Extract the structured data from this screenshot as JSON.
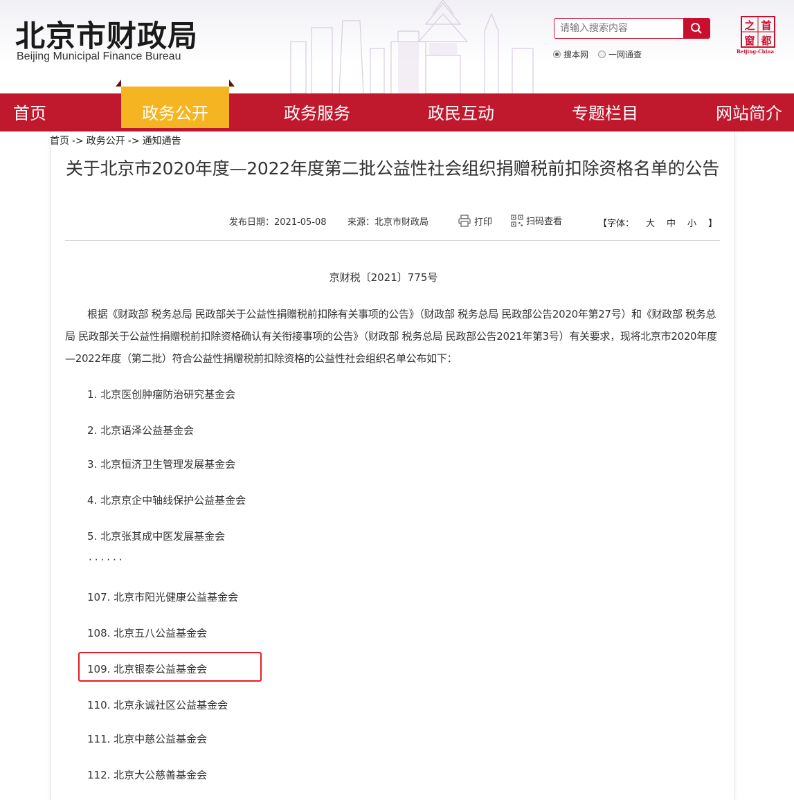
{
  "header": {
    "logo_cn": "北京市财政局",
    "logo_en": "Beijing Municipal Finance Bureau",
    "search": {
      "placeholder": "请输入搜索内容"
    },
    "search_scope": [
      {
        "label": "搜本网",
        "checked": true
      },
      {
        "label": "一网通查",
        "checked": false
      }
    ],
    "capital_logo": {
      "chars": [
        "首",
        "都",
        "之",
        "窗"
      ],
      "subtitle": "Beijing-China"
    }
  },
  "nav": {
    "items": [
      "首页",
      "政务公开",
      "政务服务",
      "政民互动",
      "专题栏目",
      "网站简介"
    ],
    "active_index": 1
  },
  "breadcrumb": {
    "items": [
      "首页",
      "政务公开",
      "通知通告"
    ],
    "separator": "->"
  },
  "article": {
    "title": "关于北京市2020年度—2022年度第二批公益性社会组织捐赠税前扣除资格名单的公告",
    "publish_date": "发布日期：2021-05-08",
    "source": "来源：北京市财政局",
    "print_label": "打印",
    "qrcode_label": "扫码查看",
    "font_size": {
      "open": "【字体：",
      "options": [
        "大",
        "中",
        "小"
      ],
      "close": "】"
    },
    "doc_number": "京财税〔2021〕775号",
    "body": "根据《财政部 税务总局 民政部关于公益性捐赠税前扣除有关事项的公告》（财政部 税务总局 民政部公告2020年第27号）和《财政部 税务总局 民政部关于公益性捐赠税前扣除资格确认有关衔接事项的公告》（财政部 税务总局 民政部公告2021年第3号）有关要求，现将北京市2020年度—2022年度（第二批）符合公益性捐赠税前扣除资格的公益性社会组织名单公布如下：",
    "list_top": [
      "1. 北京医创肿瘤防治研究基金会",
      "2. 北京语泽公益基金会",
      "3. 北京恒济卫生管理发展基金会",
      "4. 北京京企中轴线保护公益基金会",
      "5. 北京张其成中医发展基金会"
    ],
    "ellipsis": "······",
    "list_bottom": [
      "107. 北京市阳光健康公益基金会",
      "108. 北京五八公益基金会",
      "109. 北京银泰公益基金会",
      "110. 北京永诚社区公益基金会",
      "111. 北京中慈公益基金会",
      "112. 北京大公慈善基金会"
    ]
  },
  "colors": {
    "brand_red": "#c0182d",
    "active_tab": "#f5b523",
    "highlight_box": "#e51c23"
  }
}
